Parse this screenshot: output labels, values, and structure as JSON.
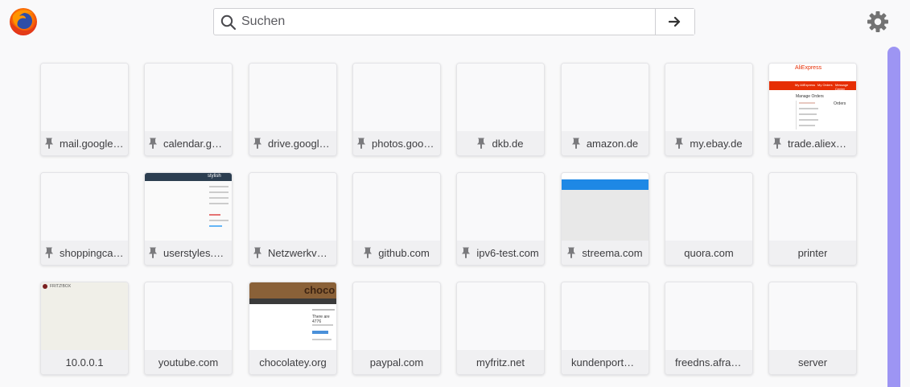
{
  "search": {
    "placeholder": "Suchen"
  },
  "icons": {
    "logo": "firefox-logo",
    "search": "search-icon",
    "submit": "arrow-right-icon",
    "settings": "gear-icon",
    "pin": "pin-icon"
  },
  "colors": {
    "accent_scroll": "#9d95f3",
    "aliexpress_red": "#e62e04",
    "streema_blue": "#1e88e5",
    "chocolatey_brown": "#7b4f2c"
  },
  "tiles": [
    {
      "label": "mail.google....",
      "pinned": true
    },
    {
      "label": "calendar.goo...",
      "pinned": true
    },
    {
      "label": "drive.google....",
      "pinned": true
    },
    {
      "label": "photos.goog...",
      "pinned": true
    },
    {
      "label": "dkb.de",
      "pinned": true
    },
    {
      "label": "amazon.de",
      "pinned": true
    },
    {
      "label": "my.ebay.de",
      "pinned": true
    },
    {
      "label": "trade.aliexpre...",
      "pinned": true,
      "thumb": "aliexpress"
    },
    {
      "label": "shoppingcart...",
      "pinned": true
    },
    {
      "label": "userstyles.org",
      "pinned": true,
      "thumb": "stylish"
    },
    {
      "label": "Netzwerkver...",
      "pinned": true
    },
    {
      "label": "github.com",
      "pinned": true
    },
    {
      "label": "ipv6-test.com",
      "pinned": true
    },
    {
      "label": "streema.com",
      "pinned": true,
      "thumb": "streema"
    },
    {
      "label": "quora.com",
      "pinned": false
    },
    {
      "label": "printer",
      "pinned": false
    },
    {
      "label": "10.0.0.1",
      "pinned": false,
      "thumb": "router"
    },
    {
      "label": "youtube.com",
      "pinned": false
    },
    {
      "label": "chocolatey.org",
      "pinned": false,
      "thumb": "chocolatey"
    },
    {
      "label": "paypal.com",
      "pinned": false
    },
    {
      "label": "myfritz.net",
      "pinned": false
    },
    {
      "label": "kundenportal.str...",
      "pinned": false
    },
    {
      "label": "freedns.afraid.org",
      "pinned": false
    },
    {
      "label": "server",
      "pinned": false
    }
  ],
  "thumb_text": {
    "aliexpress": {
      "brand": "AliExpress",
      "menu1": "My AliExpress",
      "menu2": "My Orders",
      "menu3": "Message Center",
      "heading": "Manage Orders",
      "sub": "Orders"
    },
    "stylish": {
      "brand": "stylish"
    },
    "chocolatey": {
      "brand": "choco",
      "line": "There are 4776"
    },
    "router": {
      "title": "FRITZ!BOX"
    }
  }
}
